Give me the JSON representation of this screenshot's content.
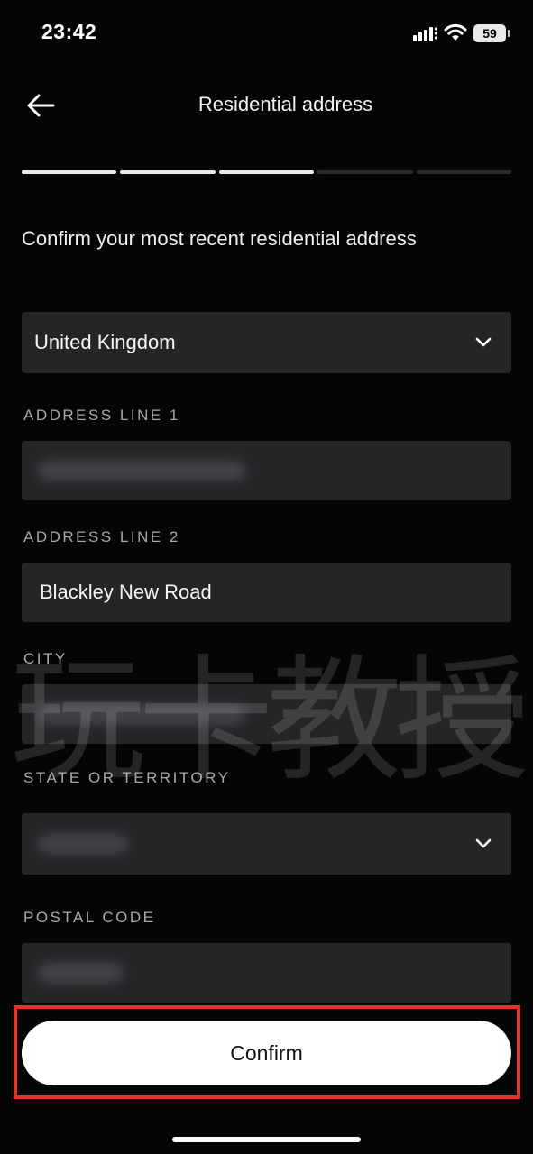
{
  "status_bar": {
    "time": "23:42",
    "battery": "59"
  },
  "header": {
    "title": "Residential address"
  },
  "progress": {
    "total_steps": 5,
    "completed_steps": 3
  },
  "prompt": "Confirm your most recent residential address",
  "country": {
    "value": "United Kingdom"
  },
  "fields": {
    "address_line_1": {
      "label": "ADDRESS LINE 1"
    },
    "address_line_2": {
      "label": "ADDRESS LINE 2",
      "value": "Blackley New Road"
    },
    "city": {
      "label": "CITY"
    },
    "state": {
      "label": "STATE OR TERRITORY"
    },
    "postal_code": {
      "label": "POSTAL CODE"
    }
  },
  "watermark": "玩卡教授",
  "confirm_button": {
    "label": "Confirm"
  },
  "colors": {
    "background": "#050505",
    "field": "#252528",
    "highlight": "#e1352c",
    "button": "#ffffff"
  }
}
